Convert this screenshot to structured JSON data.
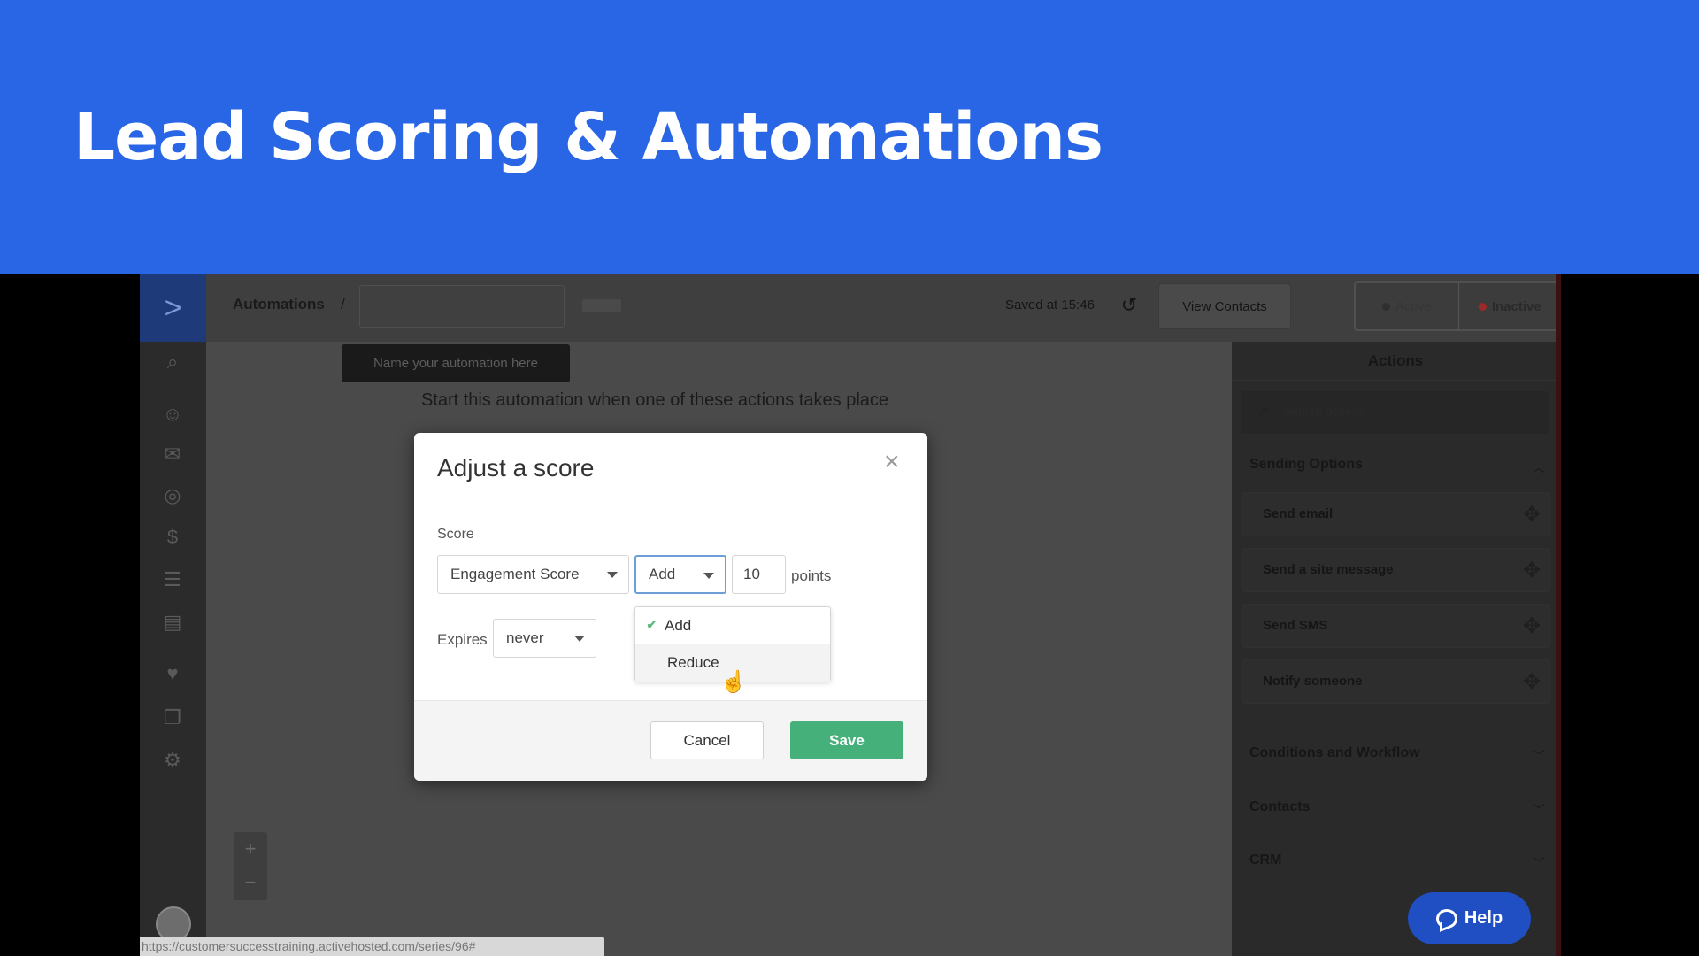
{
  "banner": {
    "title": "Lead Scoring & Automations"
  },
  "topbar": {
    "breadcrumb": "Automations",
    "breadcrumb_sep": "/",
    "saved_text": "Saved at 15:46",
    "view_contacts": "View Contacts",
    "active_label": "Active",
    "inactive_label": "Inactive"
  },
  "canvas": {
    "name_tooltip": "Name your automation here",
    "start_text": "Start this automation when one of these actions takes place",
    "zoom_in": "+",
    "zoom_out": "−"
  },
  "status_url": "https://customersuccesstraining.activehosted.com/series/96#",
  "panel": {
    "title": "Actions",
    "search_placeholder": "Search actions",
    "sections": {
      "sending_options": "Sending Options",
      "conditions": "Conditions and Workflow",
      "contacts": "Contacts",
      "crm": "CRM"
    },
    "actions": [
      "Send email",
      "Send a site message",
      "Send SMS",
      "Notify someone"
    ]
  },
  "help": {
    "label": "Help"
  },
  "modal": {
    "title": "Adjust a score",
    "close": "×",
    "score_label": "Score",
    "score_value": "Engagement Score",
    "operation_value": "Add",
    "points_value": "10",
    "points_label": "points",
    "expires_label": "Expires",
    "expires_value": "never",
    "dropdown": {
      "option_add": "Add",
      "option_reduce": "Reduce",
      "selected": "Add"
    },
    "cancel": "Cancel",
    "save": "Save"
  },
  "colors": {
    "banner": "#2866e6",
    "save_button": "#46b07a",
    "help_button": "#1f4fc2",
    "inactive_dot": "#9b2a2a"
  },
  "icons": [
    "logo-chevron-icon",
    "search-icon",
    "contacts-icon",
    "mail-icon",
    "target-icon",
    "dollar-icon",
    "list-icon",
    "form-icon",
    "heart-icon",
    "pages-icon",
    "gear-icon",
    "history-icon",
    "move-icon",
    "chevron-up-icon",
    "chevron-down-icon",
    "check-icon",
    "pointer-cursor-icon",
    "chat-icon"
  ]
}
